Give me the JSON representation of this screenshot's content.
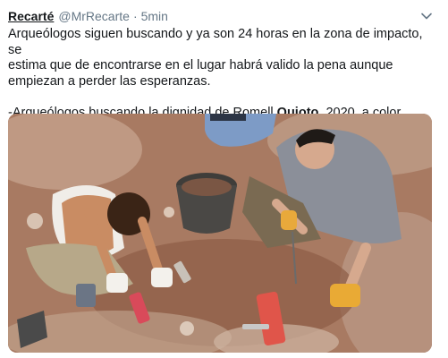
{
  "tweet": {
    "display_name": "Recarté",
    "handle": "@MrRecarte",
    "separator": "·",
    "time": "5min",
    "text_lines": [
      "Arqueólogos siguen buscando y ya son 24 horas  en la zona de impacto, se",
      "estima que de encontrarse en el lugar habrá valido la pena aunque",
      "empiezan a perder las esperanzas."
    ],
    "caption_prefix": "-Arqueólogos buscando la dignidad de Romell ",
    "caption_bold": "Quioto",
    "caption_suffix": ", 2020, a color",
    "media_description": "archaeologists-excavation-photo",
    "menu_icon": "chevron-down-icon"
  },
  "colors": {
    "text": "#14171a",
    "secondary": "#657786",
    "accent": "#1da1f2"
  }
}
